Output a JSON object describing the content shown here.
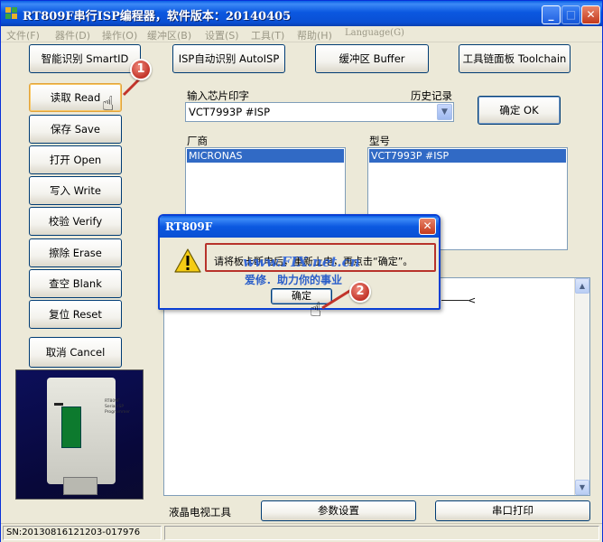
{
  "window": {
    "title": "RT809F串行ISP编程器，软件版本：20140405",
    "buttons": {
      "minimize": "_",
      "maximize": "□",
      "close": "✕"
    }
  },
  "menu": [
    "文件(F)",
    "器件(D)",
    "操作(O)",
    "缓冲区(B)",
    "设置(S)",
    "工具(T)",
    "帮助(H)",
    "Language(G)"
  ],
  "toolbar": {
    "smartid": "智能识别 SmartID",
    "autoisp": "ISP自动识别 AutoISP",
    "buffer": "缓冲区 Buffer",
    "toolchain": "工具链面板 Toolchain"
  },
  "actions": [
    "读取 Read",
    "保存 Save",
    "打开 Open",
    "写入 Write",
    "校验 Verify",
    "擦除 Erase",
    "查空 Blank",
    "复位 Reset",
    "取消 Cancel"
  ],
  "chip": {
    "input_label": "输入芯片印字",
    "history_label": "历史记录",
    "input_value": "VCT7993P #ISP",
    "ok_button": "确定 OK",
    "vendor_label": "厂商",
    "model_label": "型号",
    "vendor_selected": "MICRONAS",
    "model_selected": "VCT7993P #ISP"
  },
  "bottom": {
    "lcd_tools_label": "液晶电视工具",
    "params_button": "参数设置",
    "serial_print_button": "串口打印"
  },
  "device_photo": {
    "text": "RT809F Serial ISP Programmer"
  },
  "status": {
    "serial": "SN:20130816121203-017976",
    "message": ""
  },
  "dialog": {
    "title": "RT809F",
    "message": "请将板卡断电后，重新上电，再点击“确定”。",
    "ok_button": "确定"
  },
  "watermark": {
    "url": "www.FIX.net.cn",
    "slogan": "爱修．助力你的事业"
  },
  "annotations": {
    "step1": "1",
    "step2": "2"
  },
  "colors": {
    "titlebar": "#0a58e0",
    "selection": "#316ac5",
    "badge": "#c2342a",
    "highlight_box": "#b8332b"
  }
}
